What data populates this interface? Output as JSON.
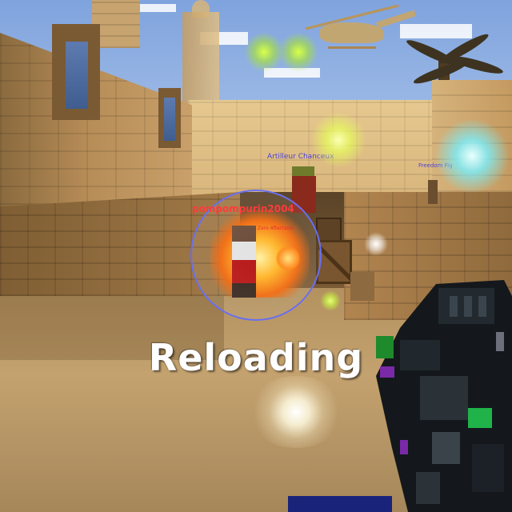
{
  "hud": {
    "status_message": "Reloading"
  },
  "players": [
    {
      "name": "Artilleur Chanceux",
      "color": "#4a3fd8"
    },
    {
      "name": "pompompurin2004",
      "color": "#ff3b3b"
    },
    {
      "name": "Zero Aftertaste",
      "color": "#e53030"
    },
    {
      "name": "Freedom Fig",
      "color": "#4a3fd8"
    }
  ],
  "icons": {
    "crosshair": "aim-ring-icon",
    "weapon": "pixel-rifle-icon",
    "helicopter": "helicopter-icon",
    "palm": "palm-tree-icon"
  },
  "colors": {
    "enemy_name": "#4a3fd8",
    "target_name": "#ff3b3b",
    "aim_ring": "#6a6ff0",
    "reload_text": "#ffffff"
  }
}
